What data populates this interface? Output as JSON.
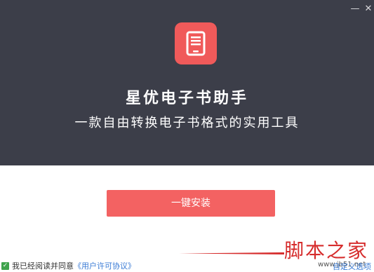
{
  "window": {
    "minimize_label": "—",
    "close_label": "✕"
  },
  "hero": {
    "title": "星优电子书助手",
    "subtitle": "一款自由转换电子书格式的实用工具",
    "logo_icon": "ebook-tablet-icon",
    "accent_color": "#f05a5a",
    "background_color": "#3c3e49"
  },
  "install_button": {
    "label": "一键安装"
  },
  "footer": {
    "agree_text": "我已经阅读并同意",
    "license_link": "《用户许可协议》",
    "custom_link": "自定义选项",
    "checked": true
  },
  "watermark": {
    "text": "脚本之家",
    "url": "www.jb51.net"
  }
}
